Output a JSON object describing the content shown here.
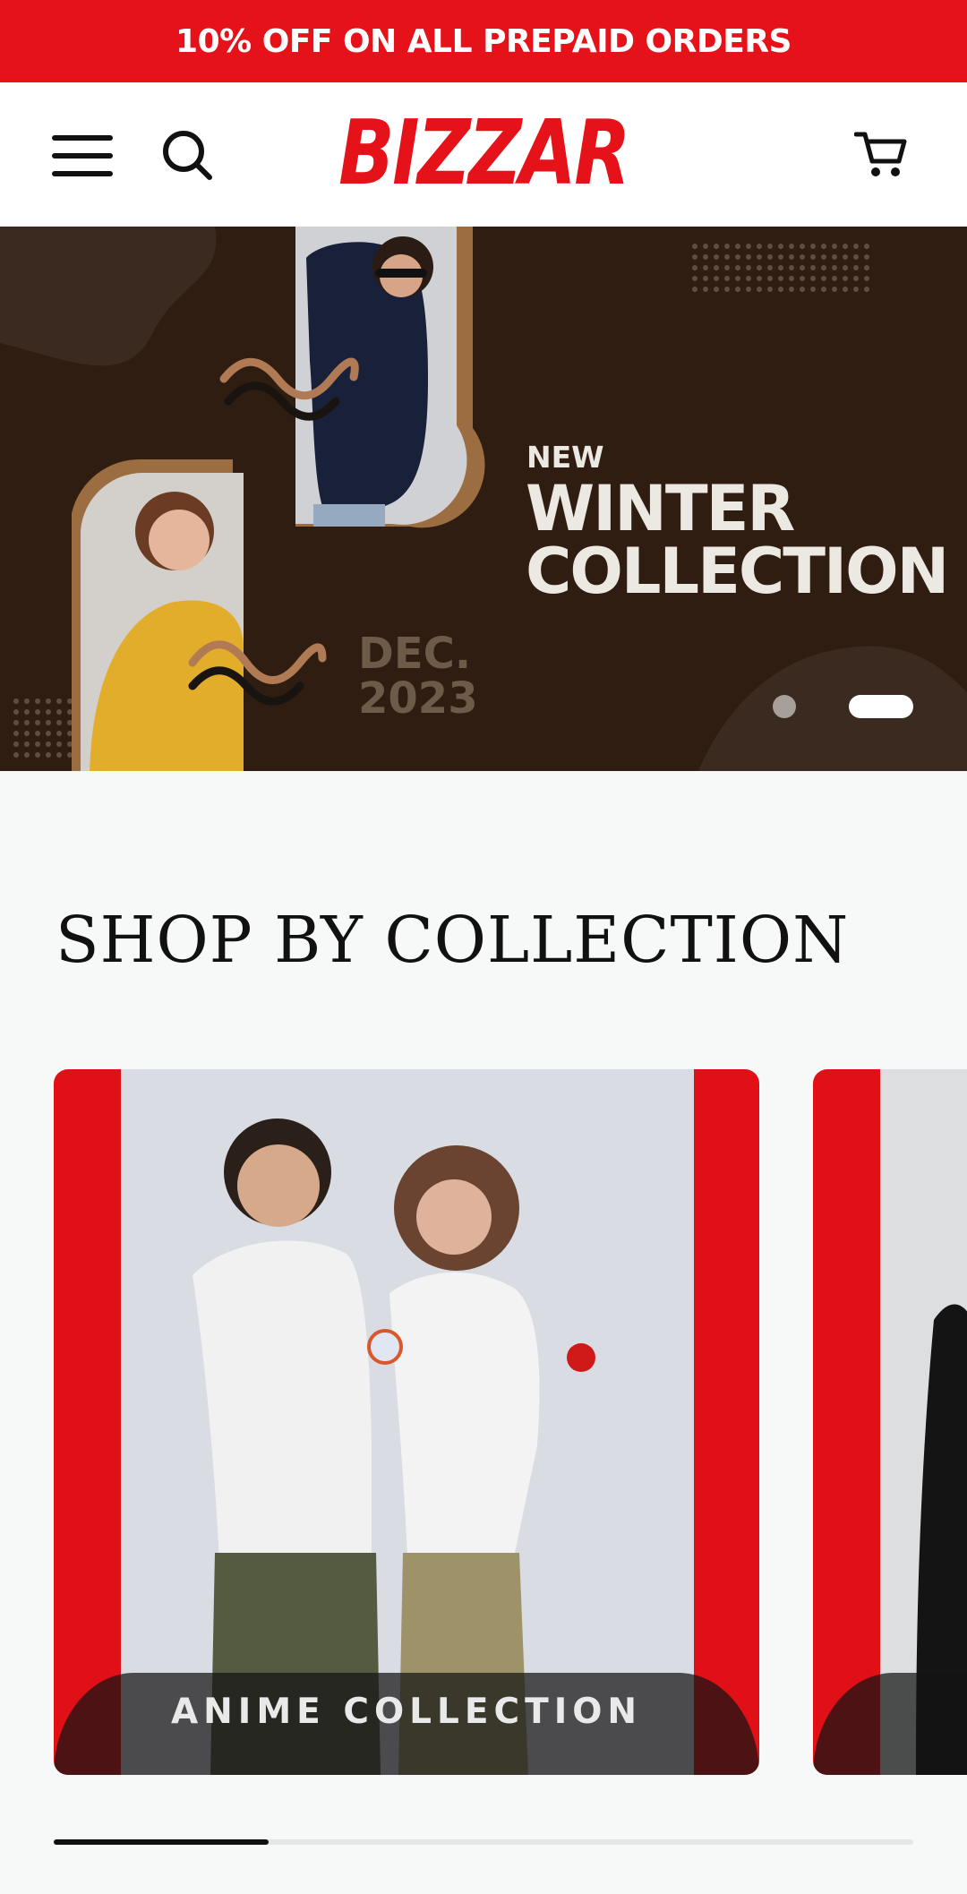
{
  "promo": {
    "text": "10% OFF ON ALL PREPAID ORDERS"
  },
  "header": {
    "logo": "BIZZAR",
    "menu_icon": "hamburger-menu-icon",
    "search_icon": "search-icon",
    "cart_icon": "shopping-cart-icon"
  },
  "hero": {
    "new_text": "NEW",
    "title": "WINTER\nCOLLECTION",
    "date": "DEC.\n2023",
    "slides_total": 2,
    "active_slide": 2
  },
  "section": {
    "title": "SHOP BY COLLECTION"
  },
  "collections": [
    {
      "label": "ANIME COLLECTION"
    },
    {
      "label": ""
    }
  ],
  "carousel_progress": 0.25,
  "colors": {
    "brand_red": "#e5121a",
    "hero_background": "#2f1d12",
    "hero_text": "#ece8e2",
    "accent_tan": "#9c6d41"
  }
}
